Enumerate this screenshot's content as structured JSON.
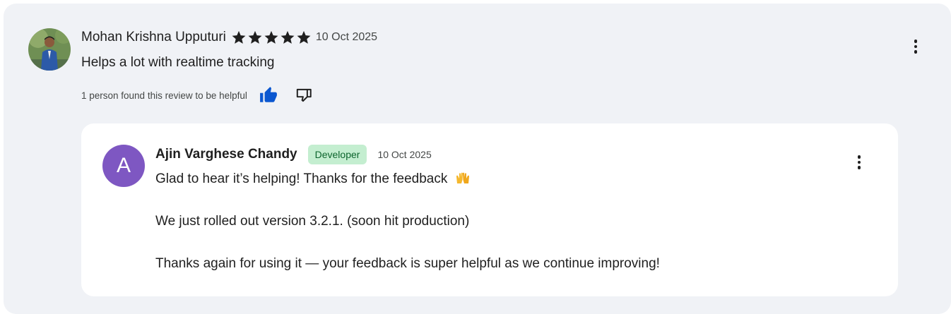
{
  "review": {
    "reviewer_name": "Mohan Krishna Upputuri",
    "rating": 5,
    "rating_max": 5,
    "date": "10 Oct 2025",
    "text": "Helps a lot with realtime tracking",
    "helpful_text": "1 person found this review to be helpful",
    "thumb_up_state": "selected",
    "icons": [
      "star-icon",
      "thumb-up-icon",
      "thumb-down-icon",
      "more-vert-icon"
    ]
  },
  "reply": {
    "avatar_letter": "A",
    "developer_name": "Ajin Varghese Chandy",
    "badge": "Developer",
    "date": "10 Oct 2025",
    "line1": "Glad to hear it’s helping! Thanks for the feedback",
    "emoji": "raising-hands-emoji",
    "line2": "We just rolled out version 3.2.1. (soon hit production)",
    "line3": "Thanks again for using it — your feedback is super helpful as we continue improving!"
  },
  "colors": {
    "card_background": "#f0f2f6",
    "reply_background": "#ffffff",
    "star": "#1f1f1f",
    "thumb_up_active": "#0b57d0",
    "developer_avatar": "#7e57c2",
    "developer_badge_bg": "#c4eed0",
    "developer_badge_text": "#0d652d"
  }
}
